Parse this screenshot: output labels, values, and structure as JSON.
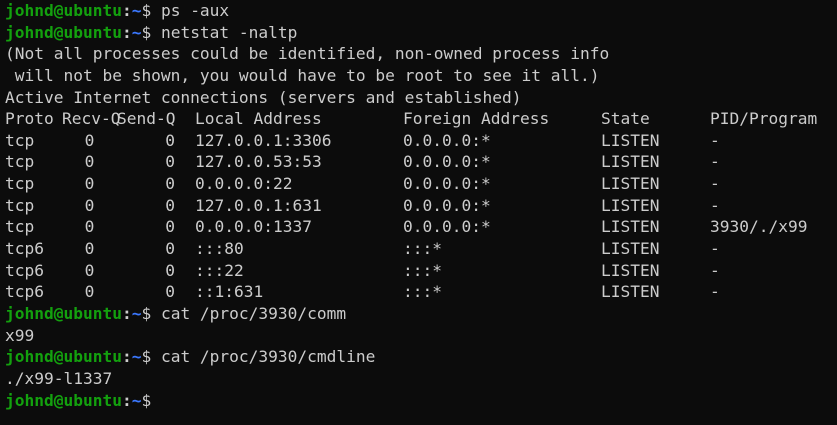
{
  "prompt": {
    "user_host": "johnd@ubuntu",
    "colon": ":",
    "path": "~",
    "dollar": "$"
  },
  "commands": {
    "c1": "ps -aux",
    "c2": "netstat -naltp",
    "c3": "cat /proc/3930/comm",
    "c4": "cat /proc/3930/cmdline"
  },
  "output": {
    "warning_1": "(Not all processes could be identified, non-owned process info",
    "warning_2": " will not be shown, you would have to be root to see it all.)",
    "active_header": "Active Internet connections (servers and established)",
    "comm_result": "x99",
    "cmdline_result": "./x99-l1337"
  },
  "netstat": {
    "headers": [
      "Proto",
      "Recv-Q",
      "Send-Q",
      "Local Address",
      "Foreign Address",
      "State",
      "PID/Program"
    ],
    "rows": [
      [
        "tcp",
        "0",
        "0",
        "127.0.0.1:3306",
        "0.0.0.0:*",
        "LISTEN",
        "-"
      ],
      [
        "tcp",
        "0",
        "0",
        "127.0.0.53:53",
        "0.0.0.0:*",
        "LISTEN",
        "-"
      ],
      [
        "tcp",
        "0",
        "0",
        "0.0.0.0:22",
        "0.0.0.0:*",
        "LISTEN",
        "-"
      ],
      [
        "tcp",
        "0",
        "0",
        "127.0.0.1:631",
        "0.0.0.0:*",
        "LISTEN",
        "-"
      ],
      [
        "tcp",
        "0",
        "0",
        "0.0.0.0:1337",
        "0.0.0.0:*",
        "LISTEN",
        "3930/./x99"
      ],
      [
        "tcp6",
        "0",
        "0",
        ":::80",
        ":::*",
        "LISTEN",
        "-"
      ],
      [
        "tcp6",
        "0",
        "0",
        ":::22",
        ":::*",
        "LISTEN",
        "-"
      ],
      [
        "tcp6",
        "0",
        "0",
        "::1:631",
        ":::*",
        "LISTEN",
        "-"
      ]
    ]
  },
  "colors": {
    "background": "#0c0c0c",
    "text": "#cccccc",
    "prompt_user": "#13a10e",
    "prompt_path": "#3b78ff"
  }
}
